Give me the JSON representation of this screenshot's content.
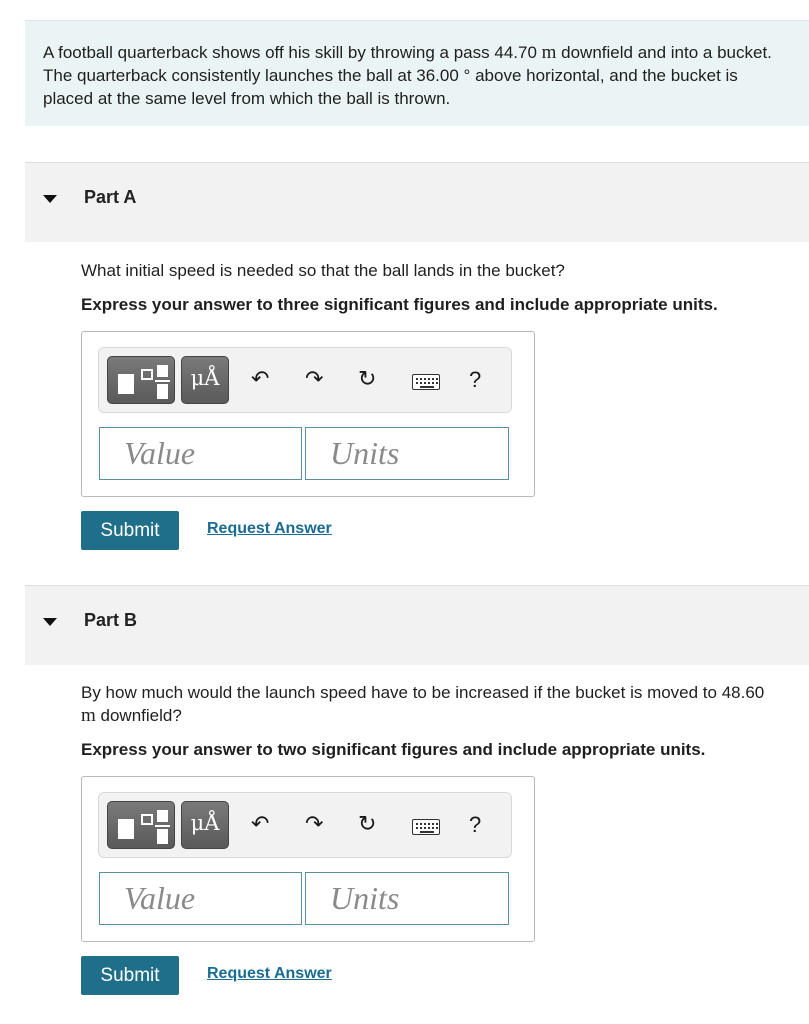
{
  "problem": {
    "text_1": "A football quarterback shows off his skill by throwing a pass 44.70 ",
    "unit_1": "m",
    "text_2": " downfield and into a bucket. The quarterback consistently launches the ball at 36.00 ",
    "degree": "°",
    "text_3": " above horizontal, and the bucket is placed at the same level from which the ball is thrown."
  },
  "parts": [
    {
      "title": "Part A",
      "question": "What initial speed is needed so that the ball lands in the bucket?",
      "instruction": "Express your answer to three significant figures and include appropriate units.",
      "value_placeholder": "Value",
      "units_placeholder": "Units",
      "submit_label": "Submit",
      "request_label": "Request Answer"
    },
    {
      "title": "Part B",
      "question_1": "By how much would the launch speed have to be increased if the bucket is moved to 48.60 ",
      "question_unit": "m",
      "question_2": " downfield?",
      "instruction": "Express your answer to two significant figures and include appropriate units.",
      "value_placeholder": "Value",
      "units_placeholder": "Units",
      "submit_label": "Submit",
      "request_label": "Request Answer"
    }
  ],
  "toolbar": {
    "units_symbol": "μÅ",
    "undo_icon": "↶",
    "redo_icon": "↷",
    "reset_icon": "↻",
    "keyboard_icon": "keyboard",
    "help_label": "?"
  },
  "colors": {
    "problem_bg": "#eaf4f5",
    "submit_bg": "#1f6f8b",
    "link": "#1a6c93",
    "field_border": "#5c8ea8"
  }
}
